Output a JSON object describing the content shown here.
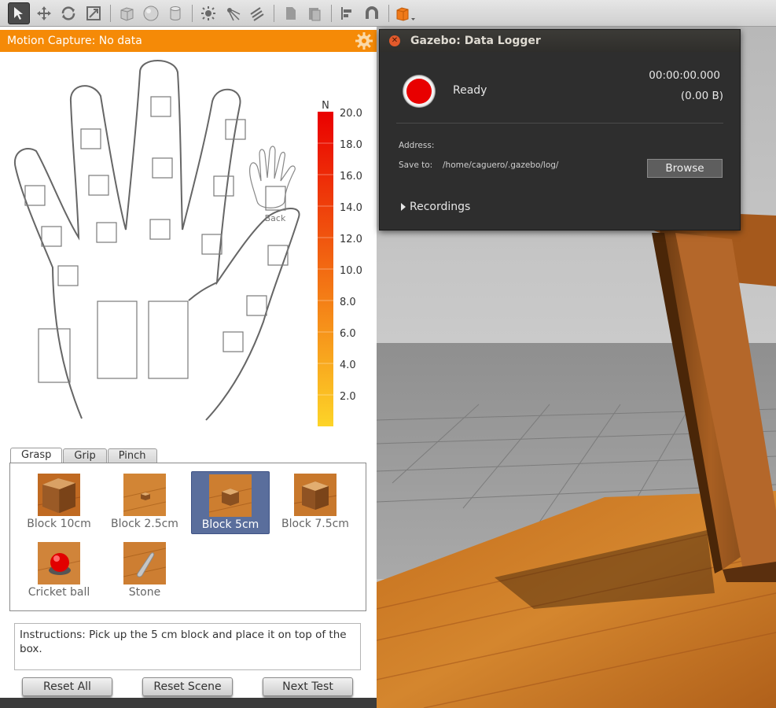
{
  "toolbar": {
    "icons": [
      "select-arrow-icon",
      "translate-icon",
      "rotate-icon",
      "scale-icon",
      "box-icon",
      "sphere-icon",
      "cylinder-icon",
      "point-light-icon",
      "spot-light-icon",
      "directional-light-icon",
      "copy-icon",
      "paste-icon",
      "align-icon",
      "snap-icon",
      "view-angle-icon"
    ]
  },
  "panel": {
    "title": "Motion Capture: No data",
    "back_label": "Back",
    "scale": {
      "unit": "N",
      "ticks": [
        "20.0",
        "18.0",
        "16.0",
        "14.0",
        "12.0",
        "10.0",
        "8.0",
        "6.0",
        "4.0",
        "2.0"
      ]
    },
    "tabs": [
      "Grasp",
      "Grip",
      "Pinch"
    ],
    "active_tab": "Grasp",
    "objects": [
      {
        "label": "Block 10cm"
      },
      {
        "label": "Block 2.5cm"
      },
      {
        "label": "Block 5cm",
        "selected": true
      },
      {
        "label": "Block 7.5cm"
      },
      {
        "label": "Cricket ball"
      },
      {
        "label": "Stone"
      }
    ],
    "instructions": "Instructions: Pick up the 5 cm block and place it on top of the box.",
    "buttons": {
      "reset_all": "Reset All",
      "reset_scene": "Reset Scene",
      "next_test": "Next Test"
    }
  },
  "dialog": {
    "title": "Gazebo: Data Logger",
    "close": "✕",
    "status": "Ready",
    "time": "00:00:00.000",
    "size": "(0.00 B)",
    "address_label": "Address:",
    "address_value": "",
    "save_to_label": "Save to:",
    "save_to_path": "/home/caguero/.gazebo/log/",
    "browse_label": "Browse",
    "recordings_label": "Recordings"
  },
  "colors": {
    "accent": "#f58a07",
    "record": "#e80000",
    "selection": "#5a6e9c"
  }
}
